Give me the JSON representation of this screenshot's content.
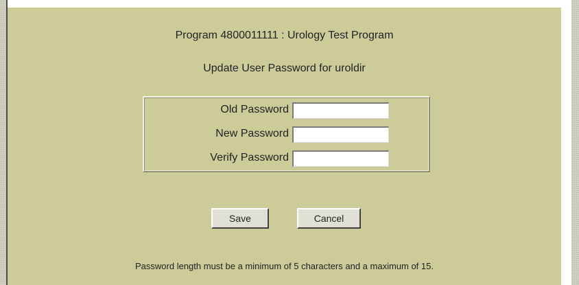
{
  "header": {
    "program_title": "Program 4800011111 : Urology Test Program",
    "update_title": "Update User Password for uroldir"
  },
  "form": {
    "old_password_label": "Old Password",
    "new_password_label": "New Password",
    "verify_password_label": "Verify Password",
    "old_password_value": "",
    "new_password_value": "",
    "verify_password_value": ""
  },
  "actions": {
    "save_label": "Save",
    "cancel_label": "Cancel"
  },
  "footer": {
    "note": "Password length must be a minimum of 5 characters and a maximum of 15."
  },
  "colors": {
    "panel_background": "#cccc99",
    "button_face": "#e0e0d4"
  }
}
